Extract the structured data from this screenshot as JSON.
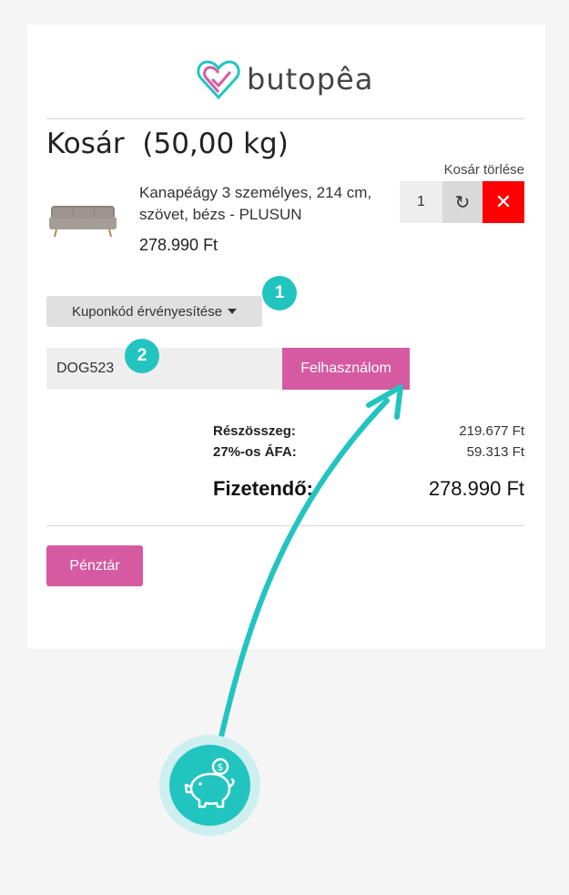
{
  "brand": {
    "name": "butopêa"
  },
  "cart": {
    "title": "Kosár",
    "weight": "(50,00 kg)",
    "clear_label": "Kosár törlése",
    "item": {
      "name": "Kanapéágy 3 személyes, 214 cm, szövet, bézs - PLUSUN",
      "price": "278.990 Ft",
      "quantity": "1",
      "refresh_icon": "refresh-icon",
      "remove_icon": "close-icon"
    }
  },
  "coupon": {
    "toggle_label": "Kuponkód érvényesítése",
    "code_value": "DOG523",
    "apply_label": "Felhasználom"
  },
  "steps": {
    "one": "1",
    "two": "2"
  },
  "summary": {
    "subtotal_label": "Részösszeg:",
    "subtotal_value": "219.677 Ft",
    "vat_label": "27%-os ÁFA:",
    "vat_value": "59.313 Ft",
    "total_label": "Fizetendő:",
    "total_value": "278.990 Ft"
  },
  "checkout": {
    "label": "Pénztár"
  },
  "colors": {
    "accent_pink": "#d65aa2",
    "accent_teal": "#22c4c0",
    "remove_red": "#ff0000"
  },
  "overlay": {
    "piggy_icon": "piggy-bank-coin-icon"
  }
}
